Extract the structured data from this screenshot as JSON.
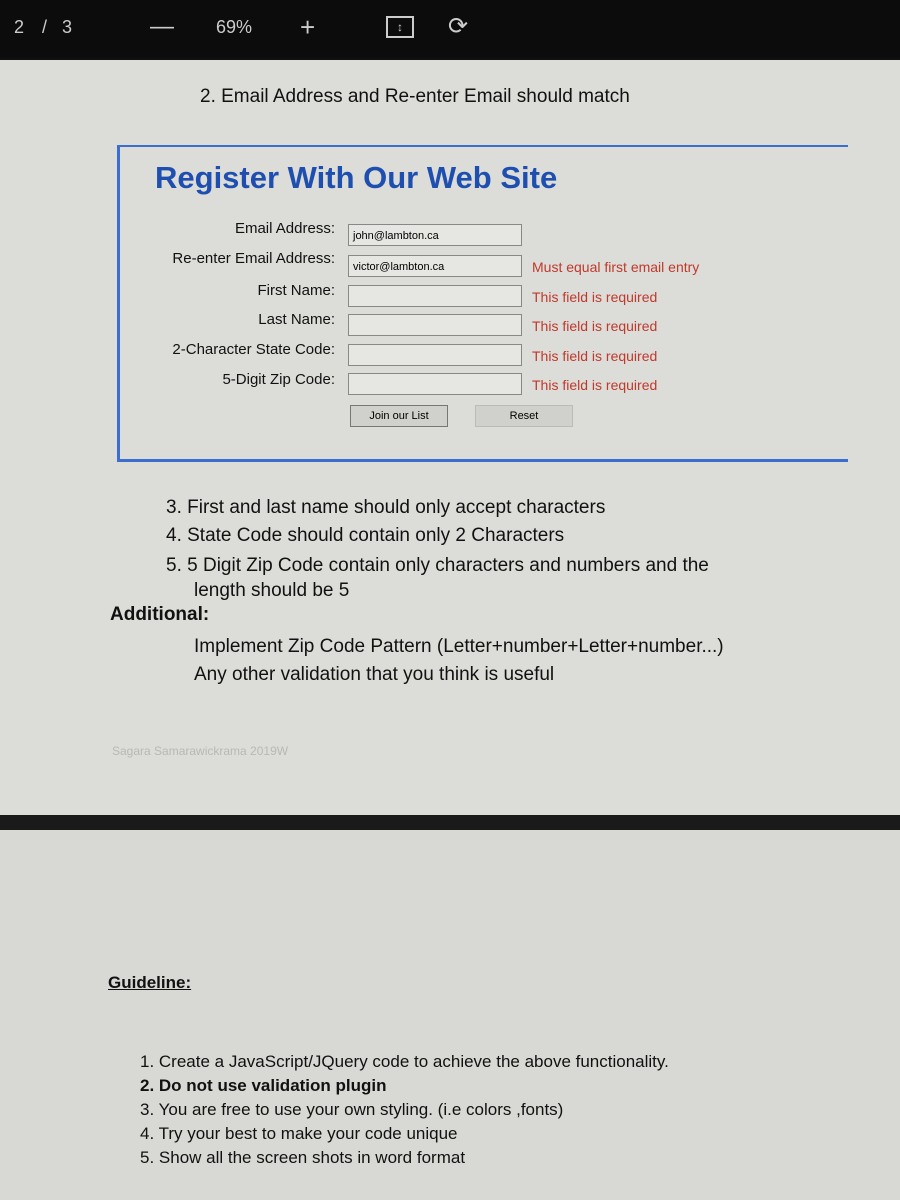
{
  "toolbar": {
    "page_current": "2",
    "page_sep": "/",
    "page_total": "3",
    "zoom": "69%",
    "icons": [
      "zoom-out-icon",
      "zoom-in-icon",
      "fit-page-icon",
      "rotate-icon"
    ]
  },
  "doc": {
    "req2": "2. Email Address and Re-enter Email should match",
    "form": {
      "title": "Register With Our Web Site",
      "fields": [
        {
          "label": "Email Address:",
          "value": "john@lambton.ca",
          "error": ""
        },
        {
          "label": "Re-enter Email Address:",
          "value": "victor@lambton.ca",
          "error": "Must equal first email entry"
        },
        {
          "label": "First Name:",
          "value": "",
          "error": "This field is required"
        },
        {
          "label": "Last Name:",
          "value": "",
          "error": "This field is required"
        },
        {
          "label": "2-Character State Code:",
          "value": "",
          "error": "This field is required"
        },
        {
          "label": "5-Digit Zip Code:",
          "value": "",
          "error": "This field is required"
        }
      ],
      "submit": "Join our List",
      "reset": "Reset"
    },
    "req3": "3. First and last name should only accept characters",
    "req4": "4. State Code should contain only 2 Characters",
    "req5a": "5. 5 Digit Zip Code contain only characters and numbers and the",
    "req5b": "length should be 5",
    "additional": "Additional:",
    "add1": "Implement Zip Code Pattern (Letter+number+Letter+number...)",
    "add2": "Any other validation that you think is useful",
    "footer": "Sagara Samarawickrama 2019W",
    "guideline": "Guideline:",
    "guides": [
      "1. Create a JavaScript/JQuery code to achieve the above functionality.",
      "2. Do not use validation plugin",
      "3. You are free to use your own styling. (i.e colors ,fonts)",
      "4. Try your best to make your code unique",
      "5. Show all the screen shots in word format"
    ]
  }
}
